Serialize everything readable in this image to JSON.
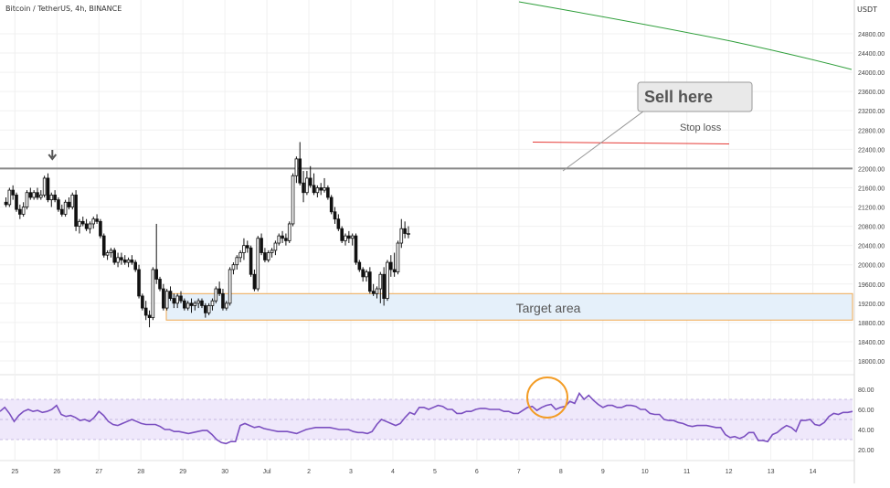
{
  "header": {
    "symbol": "Bitcoin / TetherUS, 4h, BINANCE",
    "currency": "USDT"
  },
  "annotations": {
    "callout": "Sell here",
    "stop_loss": "Stop loss",
    "target": "Target area"
  },
  "colors": {
    "up_candle": "#ffffff",
    "down_candle": "#111111",
    "candle_outline": "#111111",
    "resistance_line": "#888888",
    "stop_loss_line": "#e53935",
    "ma_line": "#2e9e3a",
    "target_fill": "#e5f0fa",
    "target_border": "#f0a850",
    "rsi_line": "#7b4fc0",
    "rsi_band": "#efe8fb",
    "highlight_circle": "#f39c25"
  },
  "chart_data": [
    {
      "type": "candlestick",
      "title": "Bitcoin / TetherUS, 4h, BINANCE",
      "ylim": [
        17600,
        25600
      ],
      "y_ticks": [
        "24800.00",
        "24400.00",
        "24000.00",
        "23600.00",
        "23200.00",
        "22800.00",
        "22400.00",
        "22000.00",
        "21600.00",
        "21200.00",
        "20800.00",
        "20400.00",
        "20000.00",
        "19600.00",
        "19200.00",
        "18800.00",
        "18400.00",
        "18000.00"
      ],
      "x_ticks": [
        {
          "label": "25",
          "idx": 1
        },
        {
          "label": "26",
          "idx": 13
        },
        {
          "label": "27",
          "idx": 25
        },
        {
          "label": "28",
          "idx": 37
        },
        {
          "label": "29",
          "idx": 49
        },
        {
          "label": "30",
          "idx": 61
        },
        {
          "label": "Jul",
          "idx": 73
        },
        {
          "label": "2",
          "idx": 85
        },
        {
          "label": "3",
          "idx": 97
        },
        {
          "label": "4",
          "idx": 109
        },
        {
          "label": "5",
          "idx": 121
        },
        {
          "label": "6",
          "idx": 133
        },
        {
          "label": "7",
          "idx": 145
        },
        {
          "label": "8",
          "idx": 157
        },
        {
          "label": "9",
          "idx": 169
        },
        {
          "label": "10",
          "idx": 181
        },
        {
          "label": "11",
          "idx": 193
        },
        {
          "label": "12",
          "idx": 205
        },
        {
          "label": "13",
          "idx": 217
        },
        {
          "label": "14",
          "idx": 229
        }
      ],
      "candles": [
        [
          21300,
          21400,
          21200,
          21250
        ],
        [
          21250,
          21600,
          21200,
          21550
        ],
        [
          21550,
          21650,
          21350,
          21450
        ],
        [
          21450,
          21500,
          21100,
          21150
        ],
        [
          21150,
          21250,
          20950,
          21050
        ],
        [
          21050,
          21300,
          21000,
          21200
        ],
        [
          21200,
          21550,
          21150,
          21500
        ],
        [
          21500,
          21600,
          21350,
          21400
        ],
        [
          21400,
          21550,
          21350,
          21500
        ],
        [
          21500,
          21600,
          21350,
          21400
        ],
        [
          21400,
          21550,
          21350,
          21450
        ],
        [
          21450,
          21850,
          21400,
          21800
        ],
        [
          21800,
          21900,
          21300,
          21350
        ],
        [
          21350,
          21500,
          21200,
          21450
        ],
        [
          21450,
          21550,
          21300,
          21350
        ],
        [
          21350,
          21400,
          21100,
          21150
        ],
        [
          21150,
          21250,
          21000,
          21050
        ],
        [
          21050,
          21350,
          21000,
          21300
        ],
        [
          21300,
          21400,
          21150,
          21200
        ],
        [
          21200,
          21500,
          21150,
          21450
        ],
        [
          21450,
          21550,
          20700,
          20800
        ],
        [
          20800,
          20950,
          20650,
          20900
        ],
        [
          20900,
          21000,
          20800,
          20850
        ],
        [
          20850,
          20950,
          20700,
          20750
        ],
        [
          20750,
          20900,
          20650,
          20850
        ],
        [
          20850,
          21000,
          20750,
          20950
        ],
        [
          20950,
          21050,
          20850,
          20900
        ],
        [
          20900,
          20950,
          20550,
          20600
        ],
        [
          20600,
          20650,
          20150,
          20200
        ],
        [
          20200,
          20300,
          20100,
          20250
        ],
        [
          20250,
          20350,
          20150,
          20300
        ],
        [
          20300,
          20350,
          20000,
          20050
        ],
        [
          20050,
          20250,
          19950,
          20150
        ],
        [
          20150,
          20250,
          20000,
          20100
        ],
        [
          20100,
          20200,
          20000,
          20050
        ],
        [
          20050,
          20150,
          19950,
          20100
        ],
        [
          20100,
          20200,
          20000,
          20050
        ],
        [
          20050,
          20100,
          19850,
          19900
        ],
        [
          19900,
          20000,
          19300,
          19350
        ],
        [
          19350,
          19400,
          19050,
          19100
        ],
        [
          19100,
          19250,
          18850,
          18950
        ],
        [
          18950,
          19050,
          18700,
          18900
        ],
        [
          18900,
          19950,
          18850,
          19900
        ],
        [
          19900,
          20850,
          19600,
          19700
        ],
        [
          19700,
          19750,
          19450,
          19500
        ],
        [
          19500,
          19600,
          19050,
          19100
        ],
        [
          19100,
          19500,
          19050,
          19450
        ],
        [
          19450,
          19550,
          19250,
          19300
        ],
        [
          19300,
          19400,
          19100,
          19200
        ],
        [
          19200,
          19400,
          19100,
          19350
        ],
        [
          19350,
          19450,
          19200,
          19250
        ],
        [
          19250,
          19300,
          19050,
          19100
        ],
        [
          19100,
          19250,
          19050,
          19200
        ],
        [
          19200,
          19300,
          19000,
          19150
        ],
        [
          19150,
          19250,
          19050,
          19200
        ],
        [
          19200,
          19300,
          19100,
          19250
        ],
        [
          19250,
          19300,
          19100,
          19150
        ],
        [
          19150,
          19200,
          18900,
          19000
        ],
        [
          19000,
          19200,
          18950,
          19150
        ],
        [
          19150,
          19300,
          19050,
          19250
        ],
        [
          19250,
          19550,
          19200,
          19500
        ],
        [
          19500,
          19650,
          19350,
          19400
        ],
        [
          19400,
          19500,
          19050,
          19100
        ],
        [
          19100,
          19250,
          19050,
          19200
        ],
        [
          19200,
          19950,
          19150,
          19900
        ],
        [
          19900,
          20050,
          19800,
          20000
        ],
        [
          20000,
          20200,
          19900,
          20150
        ],
        [
          20150,
          20300,
          20050,
          20250
        ],
        [
          20250,
          20550,
          20100,
          20400
        ],
        [
          20400,
          20500,
          20250,
          20350
        ],
        [
          20350,
          20400,
          19750,
          19800
        ],
        [
          19800,
          19900,
          19450,
          19500
        ],
        [
          19500,
          20600,
          19450,
          20550
        ],
        [
          20550,
          20650,
          20200,
          20250
        ],
        [
          20250,
          20350,
          20050,
          20100
        ],
        [
          20100,
          20300,
          20050,
          20250
        ],
        [
          20250,
          20350,
          20150,
          20300
        ],
        [
          20300,
          20500,
          20200,
          20450
        ],
        [
          20450,
          20650,
          20400,
          20600
        ],
        [
          20600,
          20700,
          20450,
          20550
        ],
        [
          20550,
          20650,
          20400,
          20500
        ],
        [
          20500,
          20900,
          20450,
          20850
        ],
        [
          20850,
          21900,
          20800,
          21850
        ],
        [
          21850,
          22250,
          21700,
          22200
        ],
        [
          22200,
          22550,
          21650,
          21700
        ],
        [
          21700,
          21950,
          21300,
          21500
        ],
        [
          21500,
          21950,
          21450,
          21800
        ],
        [
          21800,
          22050,
          21600,
          21650
        ],
        [
          21650,
          21900,
          21450,
          21500
        ],
        [
          21500,
          21650,
          21400,
          21600
        ],
        [
          21600,
          21700,
          21450,
          21550
        ],
        [
          21550,
          21800,
          21500,
          21600
        ],
        [
          21600,
          21650,
          21350,
          21400
        ],
        [
          21400,
          21450,
          21050,
          21100
        ],
        [
          21100,
          21200,
          20850,
          20950
        ],
        [
          20950,
          21050,
          20700,
          20750
        ],
        [
          20750,
          20800,
          20450,
          20500
        ],
        [
          20500,
          20650,
          20400,
          20600
        ],
        [
          20600,
          20700,
          20450,
          20550
        ],
        [
          20550,
          20650,
          20400,
          20600
        ],
        [
          20600,
          20650,
          20000,
          20050
        ],
        [
          20050,
          20100,
          19850,
          19900
        ],
        [
          19900,
          19950,
          19650,
          19750
        ],
        [
          19750,
          19900,
          19650,
          19850
        ],
        [
          19850,
          19950,
          19400,
          19450
        ],
        [
          19450,
          19600,
          19350,
          19400
        ],
        [
          19400,
          19550,
          19300,
          19500
        ],
        [
          19500,
          19850,
          19200,
          19800
        ],
        [
          19800,
          19950,
          19150,
          19300
        ],
        [
          19300,
          20100,
          19250,
          20050
        ],
        [
          20050,
          20200,
          19750,
          19900
        ],
        [
          19900,
          20250,
          19750,
          19850
        ],
        [
          19850,
          20500,
          19800,
          20450
        ],
        [
          20450,
          20950,
          20350,
          20750
        ],
        [
          20750,
          20900,
          20550,
          20650
        ],
        [
          20650,
          20800,
          20550,
          20650
        ]
      ],
      "moving_average": {
        "name": "",
        "points": [
          [
            126,
            25700
          ],
          [
            195,
            23950
          ]
        ]
      },
      "resistance_level": 22000,
      "stop_loss_level": 22550,
      "target_zone": [
        18850,
        19400
      ],
      "arrow_at_idx": 13
    },
    {
      "type": "line",
      "title": "",
      "ylim": [
        10,
        90
      ],
      "y_ticks": [
        "80.00",
        "60.00",
        "40.00",
        "20.00"
      ],
      "bands": [
        30,
        50,
        70
      ],
      "rsi_values": [
        58,
        62,
        56,
        48,
        54,
        58,
        60,
        58,
        59,
        57,
        58,
        60,
        64,
        55,
        53,
        54,
        52,
        49,
        50,
        48,
        52,
        58,
        54,
        48,
        45,
        44,
        46,
        48,
        50,
        48,
        46,
        45,
        45,
        45,
        43,
        40,
        40,
        38,
        38,
        37,
        36,
        37,
        38,
        39,
        39,
        35,
        30,
        27,
        26,
        28,
        28,
        44,
        46,
        44,
        42,
        43,
        41,
        40,
        39,
        38,
        38,
        38,
        37,
        36,
        38,
        40,
        41,
        42,
        42,
        42,
        42,
        41,
        40,
        40,
        40,
        38,
        37,
        37,
        36,
        38,
        45,
        50,
        48,
        46,
        44,
        46,
        52,
        57,
        55,
        62,
        62,
        60,
        62,
        64,
        63,
        60,
        60,
        56,
        56,
        58,
        58,
        60,
        61,
        61,
        60,
        60,
        60,
        58,
        58,
        56,
        56,
        59,
        62,
        63,
        59,
        62,
        64,
        65,
        60,
        62,
        63,
        68,
        66,
        76,
        70,
        74,
        69,
        65,
        62,
        64,
        64,
        62,
        62,
        64,
        64,
        63,
        60,
        60,
        56,
        55,
        55,
        50,
        49,
        49,
        47,
        46,
        44,
        43,
        44,
        44,
        44,
        43,
        42,
        42,
        35,
        32,
        33,
        31,
        33,
        37,
        37,
        29,
        29,
        28,
        35,
        37,
        41,
        44,
        42,
        38,
        49,
        49,
        50,
        45,
        44,
        47,
        53,
        56,
        55,
        57,
        57,
        58
      ]
    }
  ]
}
